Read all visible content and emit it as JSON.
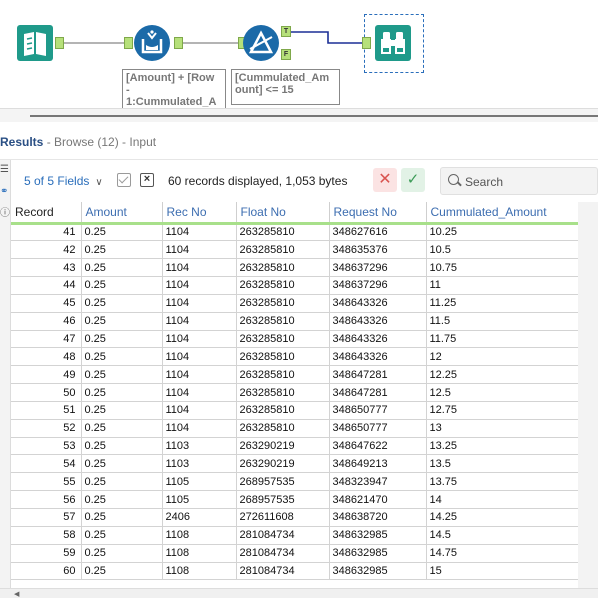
{
  "workflow": {
    "annotations": {
      "formula": [
        "[Amount] + [Row",
        "-",
        "1:Cummulated_A"
      ],
      "filter": [
        "[Cummulated_Am",
        "ount] <= 15"
      ]
    },
    "filter_true_label": "T",
    "filter_false_label": "F",
    "colors": {
      "tool_teal": "#1f9a8a",
      "tool_blue": "#1b6aa8",
      "anchor_green": "#b6e07a",
      "connection_blue": "#1c2f96"
    }
  },
  "results": {
    "title": "Results",
    "subtitle": "- Browse (12) - Input",
    "fields_label": "5 of 5 Fields",
    "record_count": "60 records displayed, 1,053 bytes",
    "search_placeholder": "Search",
    "columns": [
      "Record",
      "Amount",
      "Rec No",
      "Float No",
      "Request No",
      "Cummulated_Amount"
    ],
    "rows": [
      [
        "41",
        "0.25",
        "1104",
        "263285810",
        "348627616",
        "10.25"
      ],
      [
        "42",
        "0.25",
        "1104",
        "263285810",
        "348635376",
        "10.5"
      ],
      [
        "43",
        "0.25",
        "1104",
        "263285810",
        "348637296",
        "10.75"
      ],
      [
        "44",
        "0.25",
        "1104",
        "263285810",
        "348637296",
        "11"
      ],
      [
        "45",
        "0.25",
        "1104",
        "263285810",
        "348643326",
        "11.25"
      ],
      [
        "46",
        "0.25",
        "1104",
        "263285810",
        "348643326",
        "11.5"
      ],
      [
        "47",
        "0.25",
        "1104",
        "263285810",
        "348643326",
        "11.75"
      ],
      [
        "48",
        "0.25",
        "1104",
        "263285810",
        "348643326",
        "12"
      ],
      [
        "49",
        "0.25",
        "1104",
        "263285810",
        "348647281",
        "12.25"
      ],
      [
        "50",
        "0.25",
        "1104",
        "263285810",
        "348647281",
        "12.5"
      ],
      [
        "51",
        "0.25",
        "1104",
        "263285810",
        "348650777",
        "12.75"
      ],
      [
        "52",
        "0.25",
        "1104",
        "263285810",
        "348650777",
        "13"
      ],
      [
        "53",
        "0.25",
        "1103",
        "263290219",
        "348647622",
        "13.25"
      ],
      [
        "54",
        "0.25",
        "1103",
        "263290219",
        "348649213",
        "13.5"
      ],
      [
        "55",
        "0.25",
        "1105",
        "268957535",
        "348323947",
        "13.75"
      ],
      [
        "56",
        "0.25",
        "1105",
        "268957535",
        "348621470",
        "14"
      ],
      [
        "57",
        "0.25",
        "2406",
        "272611608",
        "348638720",
        "14.25"
      ],
      [
        "58",
        "0.25",
        "1108",
        "281084734",
        "348632985",
        "14.5"
      ],
      [
        "59",
        "0.25",
        "1108",
        "281084734",
        "348632985",
        "14.75"
      ],
      [
        "60",
        "0.25",
        "1108",
        "281084734",
        "348632985",
        "15"
      ]
    ]
  }
}
